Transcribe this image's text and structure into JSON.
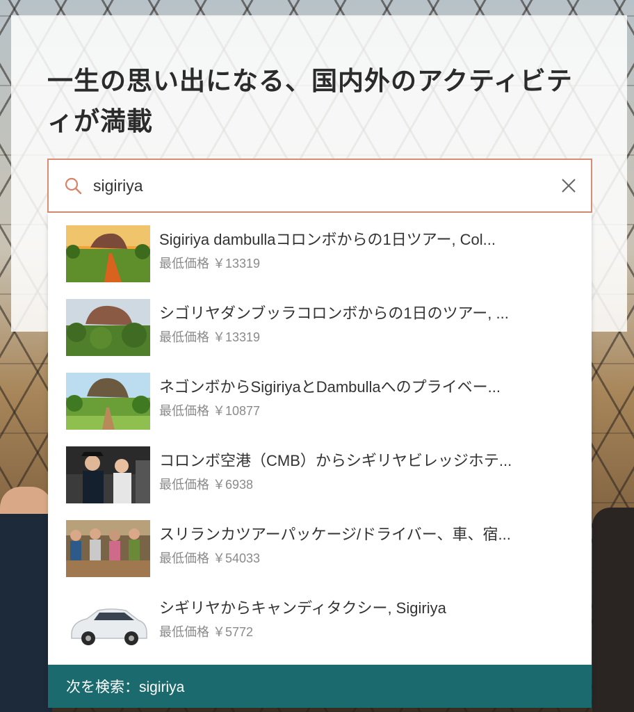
{
  "hero": {
    "headline": "一生の思い出になる、国内外のアクティビティが満載"
  },
  "search": {
    "value": "sigiriya",
    "icon": "search-icon",
    "clear_icon": "close-icon"
  },
  "results": [
    {
      "title": "Sigiriya dambullaコロンボからの1日ツアー, Col...",
      "price": "最低価格 ￥13319"
    },
    {
      "title": "シゴリヤダンブッラコロンボからの1日のツアー, ...",
      "price": "最低価格 ￥13319"
    },
    {
      "title": "ネゴンボからSigiriyaとDambullaへのプライベー...",
      "price": "最低価格 ￥10877"
    },
    {
      "title": "コロンボ空港（CMB）からシギリヤビレッジホテ...",
      "price": "最低価格 ￥6938"
    },
    {
      "title": "スリランカツアーパッケージ/ドライバー、車、宿...",
      "price": "最低価格 ￥54033"
    },
    {
      "title": "シギリヤからキャンディタクシー, Sigiriya",
      "price": "最低価格 ￥5772"
    }
  ],
  "search_more": {
    "label": "次を検索：sigiriya"
  },
  "colors": {
    "accent_border": "#d98b73",
    "footer_bg": "#1b6b6e"
  }
}
